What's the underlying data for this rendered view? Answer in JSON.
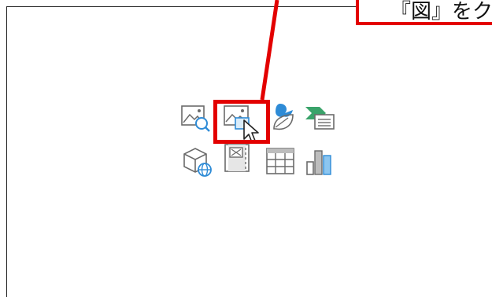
{
  "callout": {
    "text": "『図』をク"
  },
  "colors": {
    "accent_red": "#e30000",
    "icon_gray": "#6b6b6b",
    "icon_blue": "#2e8bd6",
    "icon_green": "#3aa36a"
  },
  "placeholder_icons": [
    {
      "name": "online-pictures-icon"
    },
    {
      "name": "pictures-icon"
    },
    {
      "name": "icons-icon"
    },
    {
      "name": "smartart-icon"
    },
    {
      "name": "3d-models-icon"
    },
    {
      "name": "video-icon"
    },
    {
      "name": "table-icon"
    },
    {
      "name": "chart-icon"
    }
  ]
}
